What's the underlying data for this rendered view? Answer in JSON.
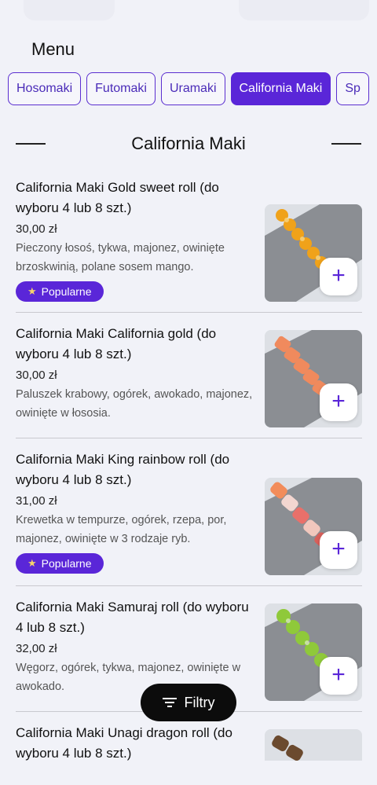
{
  "header": {
    "title": "Menu"
  },
  "tabs": [
    {
      "label": "Hosomaki",
      "active": false
    },
    {
      "label": "Futomaki",
      "active": false
    },
    {
      "label": "Uramaki",
      "active": false
    },
    {
      "label": "California Maki",
      "active": true
    },
    {
      "label": "Sp",
      "active": false
    }
  ],
  "section": {
    "title": "California Maki"
  },
  "items": [
    {
      "name": "California Maki Gold sweet roll (do wyboru 4 lub 8 szt.)",
      "price": "30,00 zł",
      "desc": "Pieczony łosoś, tykwa, majonez, owinięte brzoskwinią, polane sosem mango.",
      "badge": "Popularne",
      "thumb": "sushi-gold-roll-photo"
    },
    {
      "name": "California Maki California gold (do wyboru 4 lub 8 szt.)",
      "price": "30,00 zł",
      "desc": "Paluszek krabowy, ogórek, awokado, majonez, owinięte w łososia.",
      "badge": "",
      "thumb": "sushi-salmon-roll-photo"
    },
    {
      "name": "California Maki King rainbow roll (do wyboru 4 lub 8 szt.)",
      "price": "31,00 zł",
      "desc": "Krewetka w tempurze, ogórek, rzepa, por, majonez, owinięte w 3 rodzaje ryb.",
      "badge": "Popularne",
      "thumb": "sushi-rainbow-roll-photo"
    },
    {
      "name": "California Maki Samuraj roll (do wyboru 4 lub 8 szt.)",
      "price": "32,00 zł",
      "desc": "Węgorz, ogórek, tykwa, majonez, owinięte w awokado.",
      "badge": "",
      "thumb": "sushi-avocado-roll-photo"
    },
    {
      "name": "California Maki Unagi dragon roll (do wyboru 4 lub 8 szt.)",
      "price": "",
      "desc": "",
      "badge": "",
      "thumb": "sushi-eel-roll-photo"
    }
  ],
  "add_label": "+",
  "filter": {
    "label": "Filtry",
    "icon": "filter-icon"
  },
  "colors": {
    "accent": "#5a26d8",
    "background": "#f1f2f8"
  }
}
